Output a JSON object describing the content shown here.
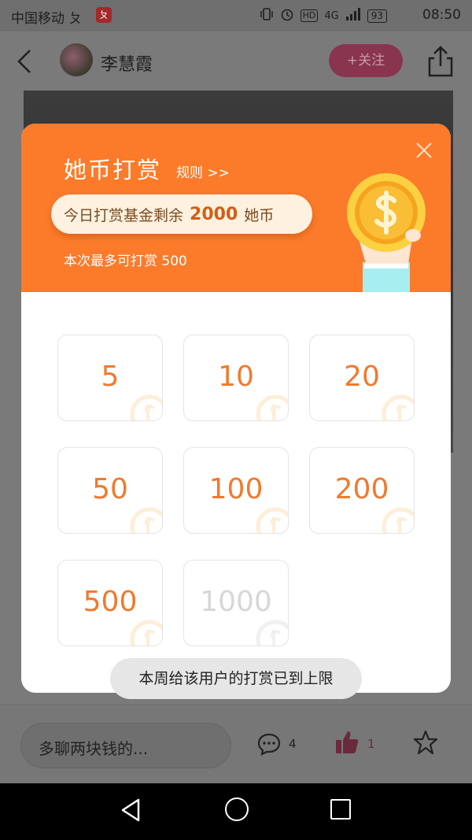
{
  "status_bar": {
    "carrier": "中国移动 ㄆ",
    "app_badge": "ㄆ",
    "network": "4G",
    "hd": "HD",
    "battery": "93",
    "time": "08:50"
  },
  "header": {
    "author_name": "李慧霞",
    "follow_label": "+关注"
  },
  "reward_modal": {
    "title": "她币打赏",
    "rules_link": "规则 >>",
    "fund_prefix": "今日打赏基金剩余",
    "fund_amount": "2000",
    "fund_unit": "她币",
    "max_note": "本次最多可打赏 500",
    "amounts": [
      {
        "value": "5",
        "enabled": true
      },
      {
        "value": "10",
        "enabled": true
      },
      {
        "value": "20",
        "enabled": true
      },
      {
        "value": "50",
        "enabled": true
      },
      {
        "value": "100",
        "enabled": true
      },
      {
        "value": "200",
        "enabled": true
      },
      {
        "value": "500",
        "enabled": true
      },
      {
        "value": "1000",
        "enabled": false
      }
    ]
  },
  "toast": "本周给该用户的打赏已到上限",
  "comment_bar": {
    "placeholder": "多聊两块钱的...",
    "comment_count": "4",
    "like_count": "1"
  },
  "colors": {
    "accent_orange": "#fb7b2a",
    "amount_text": "#f07a2e",
    "follow_button": "#8a3550"
  }
}
